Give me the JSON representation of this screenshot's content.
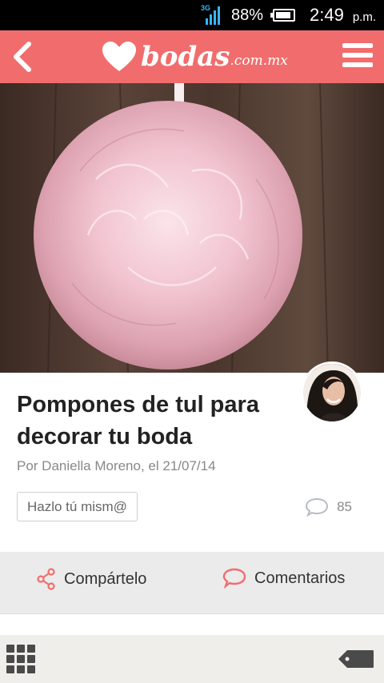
{
  "status_bar": {
    "network": "3G",
    "battery_text": "88%",
    "time": "2:49",
    "ampm": "p.m.",
    "icons": [
      "signal-icon",
      "battery-icon"
    ]
  },
  "header": {
    "brand": "bodas",
    "tld": ".com.mx",
    "icons": [
      "back-arrow-icon",
      "heart-logo-icon",
      "hamburger-menu-icon"
    ]
  },
  "article": {
    "title": "Pompones de tul para decorar tu boda",
    "byline": "Por Daniella Moreno, el 21/07/14",
    "tag": "Hazlo tú mism@",
    "comment_count": "85"
  },
  "actions": {
    "share_label": "Compártelo",
    "comments_label": "Comentarios"
  },
  "bottom_bar": {
    "icons": [
      "apps-grid-icon",
      "tag-icon"
    ]
  },
  "colors": {
    "brand": "#f16d6d",
    "accent_icons": "#f16d6d",
    "action_bar": "#ebebeb"
  }
}
